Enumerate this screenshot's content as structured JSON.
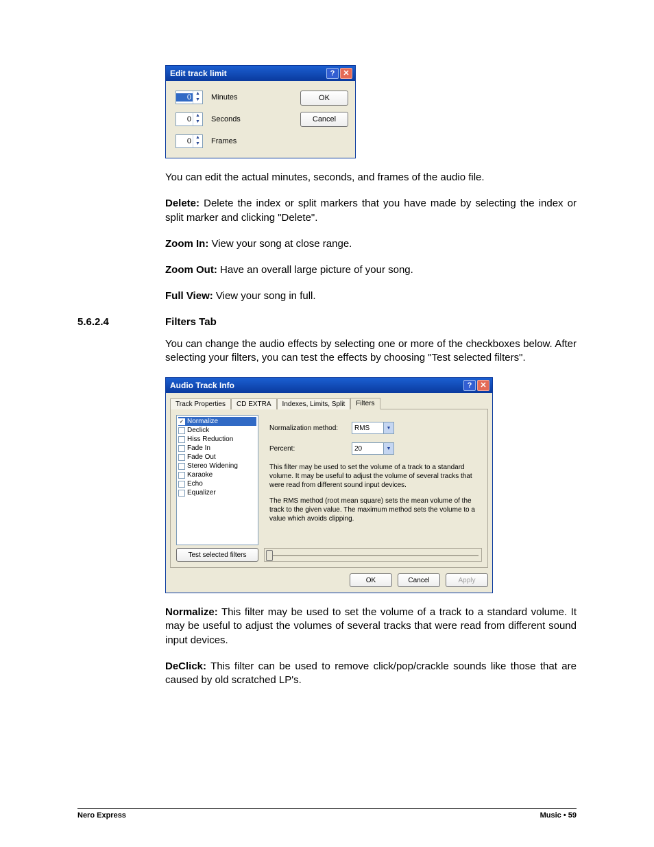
{
  "dialog1": {
    "title": "Edit track limit",
    "fields": {
      "minutes": {
        "label": "Minutes",
        "value": "0"
      },
      "seconds": {
        "label": "Seconds",
        "value": "0"
      },
      "frames": {
        "label": "Frames",
        "value": "0"
      }
    },
    "ok_label": "OK",
    "cancel_label": "Cancel"
  },
  "text": {
    "p1": "You can edit the actual minutes, seconds, and frames of the audio file.",
    "p2_b": "Delete:",
    "p2": " Delete the index or split markers that you have made by selecting the index or split marker and clicking \"Delete\".",
    "p3_b": "Zoom In:",
    "p3": " View your song at close range.",
    "p4_b": "Zoom Out:",
    "p4": " Have an overall large picture of your song.",
    "p5_b": "Full View:",
    "p5": " View your song in full.",
    "sec_num": "5.6.2.4",
    "sec_title": "Filters Tab",
    "p6": "You can change the audio effects by selecting one or more of the checkboxes below. After selecting your filters, you can test the effects by choosing \"Test selected filters\".",
    "p7_b": "Normalize:",
    "p7": " This filter may be used to set the volume of a track to a standard volume. It may be useful to adjust the volumes of several tracks that were read from different sound input devices.",
    "p8_b": "DeClick:",
    "p8": " This filter can be used to remove click/pop/crackle sounds like those that are caused by old scratched LP's."
  },
  "dialog2": {
    "title": "Audio Track Info",
    "tabs": [
      "Track Properties",
      "CD EXTRA",
      "Indexes, Limits, Split",
      "Filters"
    ],
    "active_tab": "Filters",
    "filters": [
      {
        "label": "Normalize",
        "checked": true,
        "selected": true
      },
      {
        "label": "Declick",
        "checked": false,
        "selected": false
      },
      {
        "label": "Hiss Reduction",
        "checked": false,
        "selected": false
      },
      {
        "label": "Fade In",
        "checked": false,
        "selected": false
      },
      {
        "label": "Fade Out",
        "checked": false,
        "selected": false
      },
      {
        "label": "Stereo Widening",
        "checked": false,
        "selected": false
      },
      {
        "label": "Karaoke",
        "checked": false,
        "selected": false
      },
      {
        "label": "Echo",
        "checked": false,
        "selected": false
      },
      {
        "label": "Equalizer",
        "checked": false,
        "selected": false
      }
    ],
    "norm_method_label": "Normalization method:",
    "norm_method_value": "RMS",
    "percent_label": "Percent:",
    "percent_value": "20",
    "desc1": "This filter may be used to set the volume of a track to a standard volume. It may be useful to adjust the volume of several tracks that were read from different sound input devices.",
    "desc2": "The RMS method (root mean square) sets the mean volume of the track to the given value. The maximum method sets the volume to a value which avoids clipping.",
    "test_label": "Test selected filters",
    "ok_label": "OK",
    "cancel_label": "Cancel",
    "apply_label": "Apply"
  },
  "footer": {
    "left": "Nero Express",
    "right_word": "Music",
    "right_page": "59"
  }
}
